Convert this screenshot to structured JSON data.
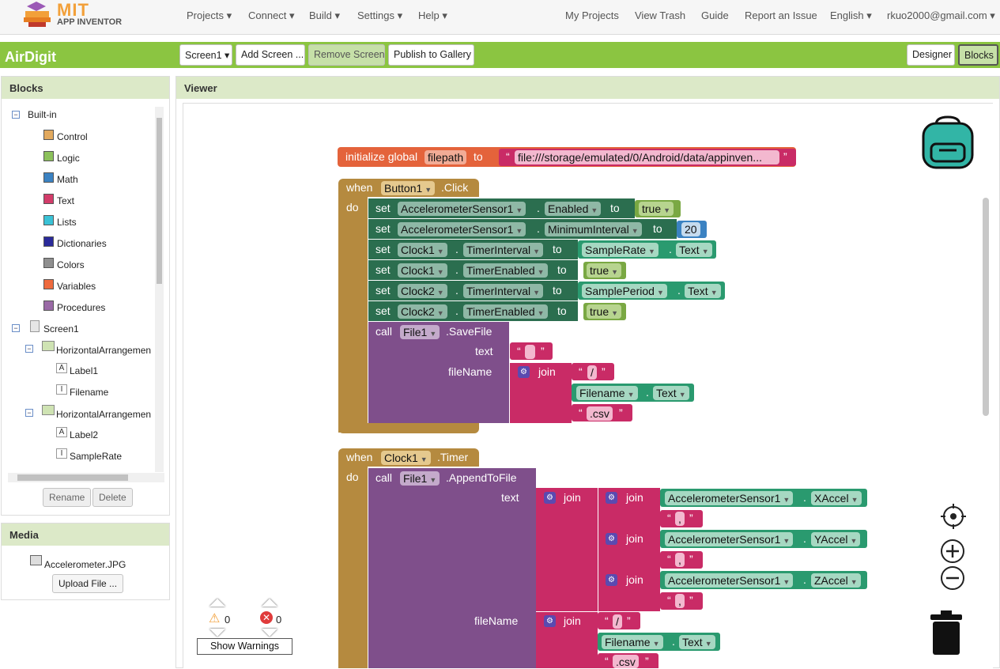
{
  "topbar": {
    "logo_mit": "MIT",
    "logo_app": "APP INVENTOR",
    "menus": [
      "Projects ▾",
      "Connect ▾",
      "Build ▾",
      "Settings ▾",
      "Help ▾"
    ],
    "links": [
      "My Projects",
      "View Trash",
      "Guide",
      "Report an Issue",
      "English ▾",
      "rkuo2000@gmail.com ▾"
    ]
  },
  "appbar": {
    "app_name": "AirDigit",
    "screen": "Screen1 ▾",
    "add_screen": "Add Screen ...",
    "remove_screen": "Remove Screen",
    "publish": "Publish to Gallery",
    "designer": "Designer",
    "blocks": "Blocks"
  },
  "blocks_panel": {
    "title": "Blocks",
    "builtin": "Built-in",
    "categories": [
      {
        "label": "Control",
        "color": "#e2a95e"
      },
      {
        "label": "Logic",
        "color": "#8cc15b"
      },
      {
        "label": "Math",
        "color": "#3b82c2"
      },
      {
        "label": "Text",
        "color": "#d33c6a"
      },
      {
        "label": "Lists",
        "color": "#3ac2d6"
      },
      {
        "label": "Dictionaries",
        "color": "#2a2a9a"
      },
      {
        "label": "Colors",
        "color": "#8f8f8f"
      },
      {
        "label": "Variables",
        "color": "#ee6a3e"
      },
      {
        "label": "Procedures",
        "color": "#9a6aa6"
      }
    ],
    "screen": "Screen1",
    "components": [
      "HorizontalArrangemen",
      "Label1",
      "Filename",
      "HorizontalArrangemen",
      "Label2",
      "SampleRate"
    ],
    "rename": "Rename",
    "delete": "Delete"
  },
  "media": {
    "title": "Media",
    "file": "Accelerometer.JPG",
    "upload": "Upload File ..."
  },
  "viewer": {
    "title": "Viewer",
    "warnings_count": "0",
    "errors_count": "0",
    "show_warnings": "Show Warnings"
  },
  "blocks": {
    "init_label": "initialize global",
    "init_var": "filepath",
    "to": "to",
    "init_value": "file:///storage/emulated/0/Android/data/appinven...",
    "when": "when",
    "do": "do",
    "set": "set",
    "call": "call",
    "join": "join",
    "dot": ".",
    "btn_component": "Button1",
    "btn_event": ".Click",
    "accel": "AccelerometerSensor1",
    "enabled": "Enabled",
    "min_interval": "MinimumInterval",
    "true_val": "true",
    "num_20": "20",
    "clock1": "Clock1",
    "clock2": "Clock2",
    "timer_interval": "TimerInterval",
    "timer_enabled": "TimerEnabled",
    "sample_rate": "SampleRate",
    "sample_period": "SamplePeriod",
    "text_prop": "Text",
    "file1": "File1",
    "save_file": ".SaveFile",
    "append_file": ".AppendToFile",
    "text_label": "text",
    "filename_label": "fileName",
    "filename_comp": "Filename",
    "slash": "/",
    "csv": ".csv",
    "comma": ",",
    "timer_event": ".Timer",
    "xaccel": "XAccel",
    "yaccel": "YAccel",
    "zaccel": "ZAccel",
    "quote_open": "“",
    "quote_close": "”"
  }
}
